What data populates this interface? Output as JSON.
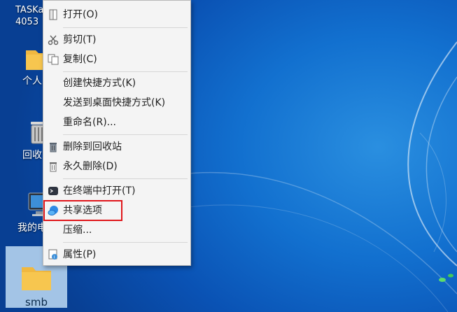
{
  "desktop": {
    "task_label_line1": "TASKa",
    "task_label_line2": "4053",
    "icons": [
      {
        "label": "个人",
        "icon": "folder-icon"
      },
      {
        "label": "回收",
        "icon": "trash-icon"
      },
      {
        "label": "我的电",
        "icon": "computer-icon"
      },
      {
        "label": "smb",
        "icon": "folder-icon"
      }
    ]
  },
  "context_menu": {
    "open": "打开(O)",
    "cut": "剪切(T)",
    "copy": "复制(C)",
    "create_shortcut": "创建快捷方式(K)",
    "send_to_desktop": "发送到桌面快捷方式(K)",
    "rename": "重命名(R)...",
    "delete_to_trash": "删除到回收站",
    "delete_permanently": "永久删除(D)",
    "open_in_terminal": "在终端中打开(T)",
    "share_options": "共享选项",
    "compress": "压缩...",
    "properties": "属性(P)"
  },
  "colors": {
    "highlight_border": "#e0161b",
    "menu_background": "#f4f4f4",
    "desktop_blue": "#1270cf"
  }
}
